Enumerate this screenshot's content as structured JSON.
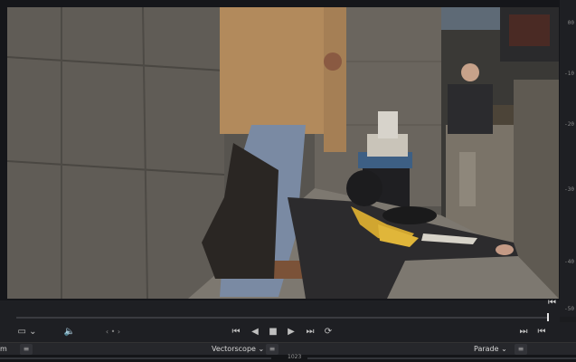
{
  "viewer": {
    "frame_description_alt": ""
  },
  "ruler": {
    "ticks": [
      "00",
      "-10",
      "-20",
      "-30",
      "-40",
      "-50"
    ]
  },
  "transport": {
    "view_options_icon": "view-options-icon",
    "volume_icon": "volume-icon",
    "jump_start_icon": "jump-to-start-icon",
    "step_back_icon": "step-back-icon",
    "stop_icon": "stop-icon",
    "play_icon": "play-icon",
    "jump_end_icon": "jump-to-end-icon",
    "loop_icon": "loop-icon",
    "chevrons": "‹ • ›"
  },
  "scopes": {
    "left_cut": "m",
    "vectorscope_label": "Vectorscope",
    "parade_label": "Parade"
  },
  "bottom": {
    "value": "1023"
  }
}
